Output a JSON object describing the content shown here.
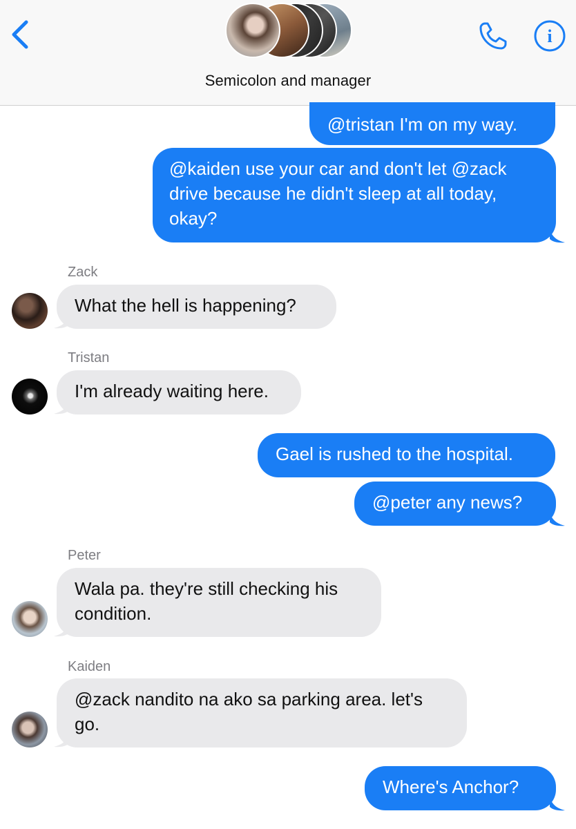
{
  "header": {
    "title": "Semicolon and manager",
    "back_icon": "chevron-left-icon",
    "phone_icon": "phone-icon",
    "info_icon": "info-icon",
    "accent_color": "#1a7ef5"
  },
  "messages": [
    {
      "direction": "outgoing",
      "text": "@tristan I'm on my way."
    },
    {
      "direction": "outgoing",
      "text": "@kaiden use your car and don't let @zack drive because he didn't sleep at all today, okay?"
    },
    {
      "direction": "incoming",
      "sender": "Zack",
      "text": "What the hell is happening?"
    },
    {
      "direction": "incoming",
      "sender": "Tristan",
      "text": "I'm already waiting here."
    },
    {
      "direction": "outgoing",
      "text": "Gael is rushed to the hospital."
    },
    {
      "direction": "outgoing",
      "text": "@peter any news?"
    },
    {
      "direction": "incoming",
      "sender": "Peter",
      "text": "Wala pa. they're still checking his condition."
    },
    {
      "direction": "incoming",
      "sender": "Kaiden",
      "text": "@zack nandito na ako sa parking area. let's go."
    },
    {
      "direction": "outgoing",
      "text": "Where's Anchor?"
    }
  ],
  "colors": {
    "outgoing_bubble": "#1a7ef5",
    "incoming_bubble": "#e9e9eb"
  }
}
